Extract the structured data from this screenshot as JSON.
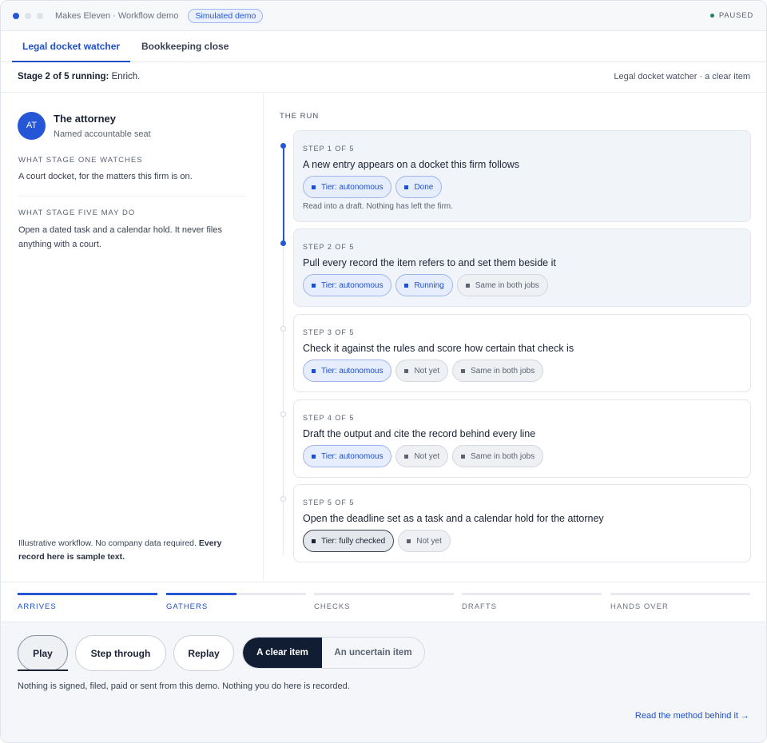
{
  "window": {
    "title": "Makes Eleven · Workflow demo",
    "badge": "Simulated demo",
    "status": "PAUSED"
  },
  "tabs": [
    {
      "label": "Legal docket watcher",
      "active": true
    },
    {
      "label": "Bookkeeping close",
      "active": false
    }
  ],
  "status_row": {
    "stage_prefix": "Stage 2 of 5 running:",
    "stage_name": "Enrich.",
    "right_text": "Legal docket watcher · a clear item"
  },
  "seat": {
    "initials": "AT",
    "name": "The attorney",
    "role": "Named accountable seat"
  },
  "left_panel": {
    "watches_heading": "WHAT STAGE ONE WATCHES",
    "watches_text": "A court docket, for the matters this firm is on.",
    "may_do_heading": "WHAT STAGE FIVE MAY DO",
    "may_do_text": "Open a dated task and a calendar hold. It never files anything with a court.",
    "footer_plain": "Illustrative workflow. No company data required.",
    "footer_bold": "Every record here is sample text."
  },
  "run": {
    "heading": "THE RUN",
    "steps": [
      {
        "num": "STEP 1 OF 5",
        "title": "A new entry appears on a docket this firm follows",
        "chips": [
          "Tier: autonomous",
          "Done"
        ],
        "note": "Read into a draft. Nothing has left the firm."
      },
      {
        "num": "STEP 2 OF 5",
        "title": "Pull every record the item refers to and set them beside it",
        "chips": [
          "Tier: autonomous",
          "Running",
          "Same in both jobs"
        ]
      },
      {
        "num": "STEP 3 OF 5",
        "title": "Check it against the rules and score how certain that check is",
        "chips": [
          "Tier: autonomous",
          "Not yet",
          "Same in both jobs"
        ]
      },
      {
        "num": "STEP 4 OF 5",
        "title": "Draft the output and cite the record behind every line",
        "chips": [
          "Tier: autonomous",
          "Not yet",
          "Same in both jobs"
        ]
      },
      {
        "num": "STEP 5 OF 5",
        "title": "Open the deadline set as a task and a calendar hold for the attorney",
        "chips": [
          "Tier: fully checked",
          "Not yet"
        ]
      }
    ]
  },
  "progress": [
    {
      "label": "ARRIVES",
      "fill": 1.0
    },
    {
      "label": "GATHERS",
      "fill": 0.5
    },
    {
      "label": "CHECKS",
      "fill": 0
    },
    {
      "label": "DRAFTS",
      "fill": 0
    },
    {
      "label": "HANDS OVER",
      "fill": 0
    }
  ],
  "controls": {
    "play": "Play",
    "step_through": "Step through",
    "replay": "Replay",
    "clear_item": "A clear item",
    "uncertain_item": "An uncertain item",
    "note": "Nothing is signed, filed, paid or sent from this demo. Nothing you do here is recorded.",
    "method_link": "Read the method behind it →"
  },
  "colors": {
    "accent": "#2456d6",
    "dark": "#111d33",
    "success_dot": "#178a5a"
  }
}
